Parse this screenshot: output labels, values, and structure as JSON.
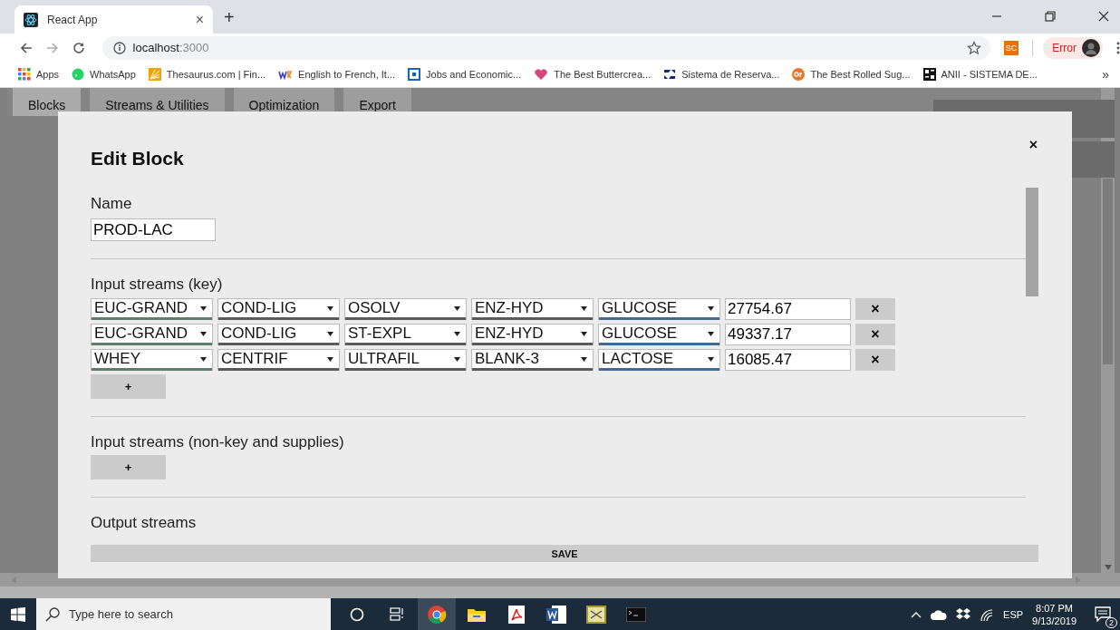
{
  "browser": {
    "tab": {
      "title": "React App",
      "close": "×"
    },
    "new_tab": "+",
    "url": {
      "host": "localhost",
      "port": ":3000"
    },
    "extension": "SC",
    "profile": "Error",
    "bookmarks": [
      {
        "label": "Apps"
      },
      {
        "label": "WhatsApp"
      },
      {
        "label": "Thesaurus.com | Fin..."
      },
      {
        "label": "English to French, It..."
      },
      {
        "label": "Jobs and Economic..."
      },
      {
        "label": "The Best Buttercrea..."
      },
      {
        "label": "Sistema de Reserva..."
      },
      {
        "label": "The Best Rolled Sug..."
      },
      {
        "label": "ANII - SISTEMA DE..."
      }
    ],
    "more": "»"
  },
  "app_tabs": [
    {
      "label": "Blocks",
      "selected": true
    },
    {
      "label": "Streams & Utilities",
      "selected": false
    },
    {
      "label": "Optimization",
      "selected": false
    },
    {
      "label": "Export",
      "selected": false
    }
  ],
  "modal": {
    "title": "Edit Block",
    "close": "×",
    "name": {
      "label": "Name",
      "value": "PROD-LAC"
    },
    "sections": [
      {
        "title": "Input streams (key)",
        "add": "+",
        "rows": [
          {
            "selects": [
              {
                "value": "EUC-GRAND",
                "color": "#5e7d6c"
              },
              {
                "value": "COND-LIG",
                "color": "#5a5a5a"
              },
              {
                "value": "OSOLV",
                "color": "#5a5a5a"
              },
              {
                "value": "ENZ-HYD",
                "color": "#5a5a5a"
              },
              {
                "value": "GLUCOSE",
                "color": "#46698f"
              }
            ],
            "amount": "27754.67",
            "remove": "×"
          },
          {
            "selects": [
              {
                "value": "EUC-GRAND",
                "color": "#5e7d6c"
              },
              {
                "value": "COND-LIG",
                "color": "#5a5a5a"
              },
              {
                "value": "ST-EXPL",
                "color": "#5a5a5a"
              },
              {
                "value": "ENZ-HYD",
                "color": "#5a5a5a"
              },
              {
                "value": "GLUCOSE",
                "color": "#46698f"
              }
            ],
            "amount": "49337.17",
            "remove": "×"
          },
          {
            "selects": [
              {
                "value": "WHEY",
                "color": "#5e7d6c"
              },
              {
                "value": "CENTRIF",
                "color": "#5a5a5a"
              },
              {
                "value": "ULTRAFIL",
                "color": "#5a5a5a"
              },
              {
                "value": "BLANK-3",
                "color": "#5a5a5a"
              },
              {
                "value": "LACTOSE",
                "color": "#46698f"
              }
            ],
            "amount": "16085.47",
            "remove": "×"
          }
        ]
      },
      {
        "title": "Input streams (non-key and supplies)",
        "add": "+"
      },
      {
        "title": "Output streams"
      }
    ],
    "save": "SAVE"
  },
  "taskbar": {
    "search": {
      "placeholder": "Type here to search"
    },
    "apps": [
      {
        "selected": false
      },
      {
        "selected": false
      },
      {
        "selected": true
      },
      {
        "selected": false
      },
      {
        "selected": false
      },
      {
        "selected": false
      },
      {
        "selected": false
      },
      {
        "selected": false
      }
    ],
    "language": "ESP",
    "time": "8:07 PM",
    "date": "9/13/2019",
    "notifications": "2"
  }
}
